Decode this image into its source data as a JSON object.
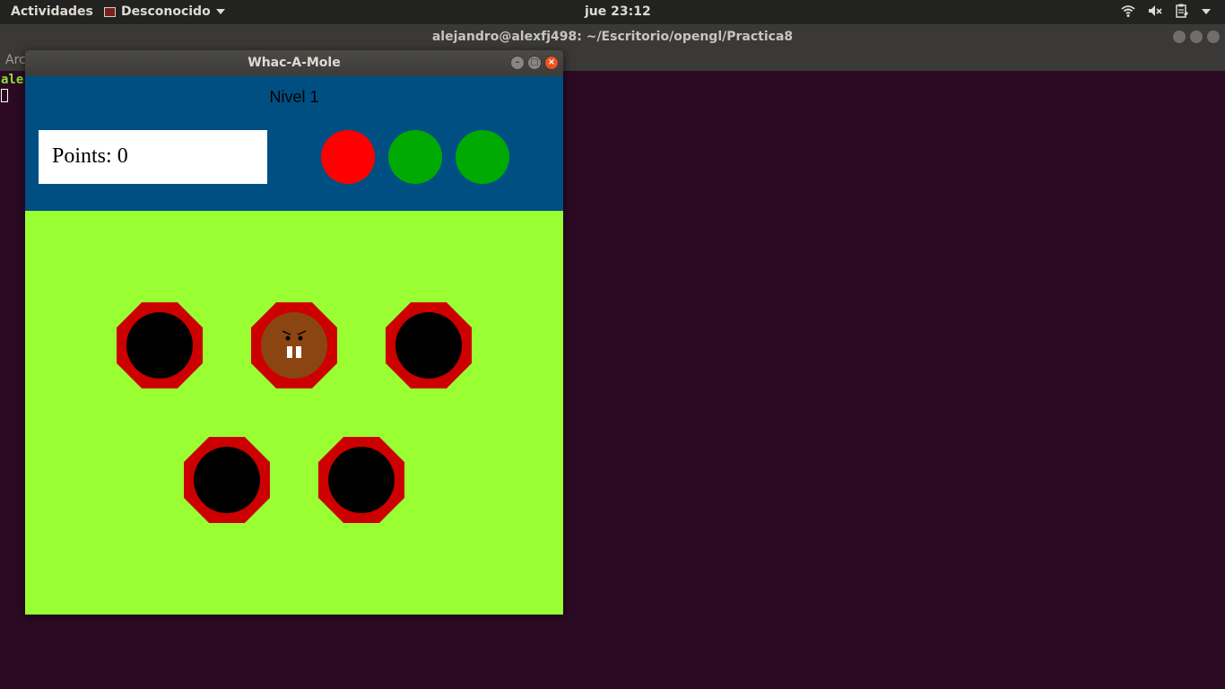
{
  "topbar": {
    "activities": "Actividades",
    "app_name": "Desconocido",
    "clock": "jue 23:12",
    "tray_icons": [
      "wifi-icon",
      "volume-muted-icon",
      "clipboard-icon",
      "system-menu-arrow-icon"
    ]
  },
  "terminal": {
    "title": "alejandro@alexfj498: ~/Escritorio/opengl/Practica8",
    "menu_partial": "Arc",
    "prompt_partial": "ale"
  },
  "game": {
    "window_title": "Whac-A-Mole",
    "level_text": "Nivel 1",
    "points_text": "Points: 0",
    "lives": [
      {
        "color": "#ff0000",
        "state": "lost"
      },
      {
        "color": "#00aa00",
        "state": "remaining"
      },
      {
        "color": "#00aa00",
        "state": "remaining"
      }
    ],
    "holes": [
      {
        "row": 1,
        "col": 1,
        "mole": false
      },
      {
        "row": 1,
        "col": 2,
        "mole": true
      },
      {
        "row": 1,
        "col": 3,
        "mole": false
      },
      {
        "row": 2,
        "col": 1,
        "mole": false
      },
      {
        "row": 2,
        "col": 2,
        "mole": false
      }
    ],
    "colors": {
      "hud_bg": "#004f83",
      "field_bg": "#99ff33",
      "hole_rim": "#cc0000",
      "hole": "#000000",
      "mole": "#8b4513"
    }
  }
}
